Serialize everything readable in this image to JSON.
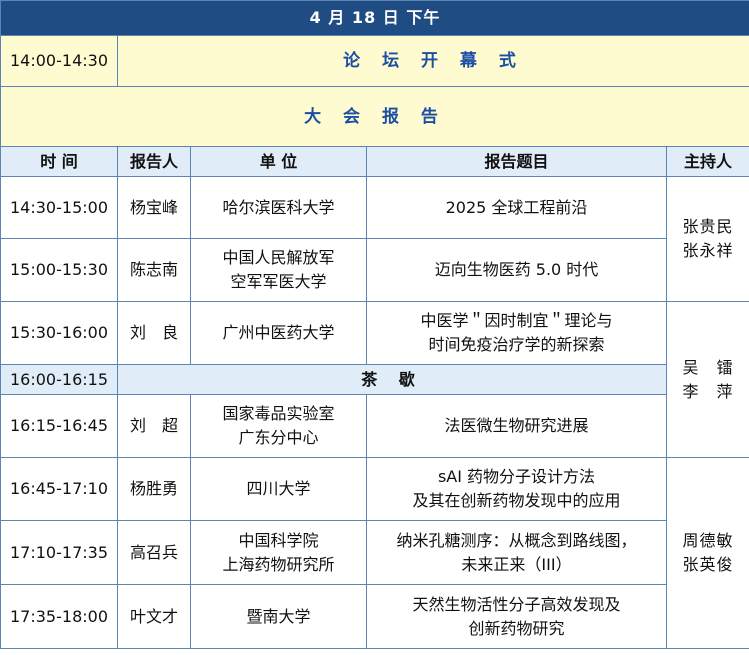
{
  "header": {
    "date": "4 月 18 日  下午"
  },
  "opening": {
    "time": "14:00-14:30",
    "title": "论 坛 开 幕 式"
  },
  "plenary": {
    "title": "大 会 报 告"
  },
  "columns": {
    "time": "时 间",
    "speaker": "报告人",
    "unit": "单 位",
    "topic": "报告题目",
    "host": "主持人"
  },
  "rows": [
    {
      "time": "14:30-15:00",
      "speaker": "杨宝峰",
      "unit": [
        "哈尔滨医科大学"
      ],
      "topic": [
        "2025 全球工程前沿"
      ]
    },
    {
      "time": "15:00-15:30",
      "speaker": "陈志南",
      "unit": [
        "中国人民解放军",
        "空军军医大学"
      ],
      "topic": [
        "迈向生物医药 5.0 时代"
      ]
    },
    {
      "time": "15:30-16:00",
      "speaker": "刘　良",
      "unit": [
        "广州中医药大学"
      ],
      "topic": [
        "中医学＂因时制宜＂理论与",
        "时间免疫治疗学的新探索"
      ]
    },
    {
      "time": "16:15-16:45",
      "speaker": "刘　超",
      "unit": [
        "国家毒品实验室",
        "广东分中心"
      ],
      "topic": [
        "法医微生物研究进展"
      ]
    },
    {
      "time": "16:45-17:10",
      "speaker": "杨胜勇",
      "unit": [
        "四川大学"
      ],
      "topic": [
        "sAI 药物分子设计方法",
        "及其在创新药物发现中的应用"
      ]
    },
    {
      "time": "17:10-17:35",
      "speaker": "高召兵",
      "unit": [
        "中国科学院",
        "上海药物研究所"
      ],
      "topic": [
        "纳米孔糖测序：从概念到路线图，",
        "未来正来（III）"
      ]
    },
    {
      "time": "17:35-18:00",
      "speaker": "叶文才",
      "unit": [
        "暨南大学"
      ],
      "topic": [
        "天然生物活性分子高效发现及",
        "创新药物研究"
      ]
    }
  ],
  "tea_break": {
    "time": "16:00-16:15",
    "title": "茶 歇"
  },
  "hosts": [
    [
      "张贵民",
      "张永祥"
    ],
    [
      "吴　镭",
      "李　萍"
    ],
    [
      "周德敏",
      "张英俊"
    ]
  ],
  "colors": {
    "header_bg": "#1f4c83",
    "accent_text": "#1c4ea6",
    "yellow_bg": "#fffbd0",
    "light_blue_bg": "#e0ecf8",
    "border": "#5b86b4"
  }
}
